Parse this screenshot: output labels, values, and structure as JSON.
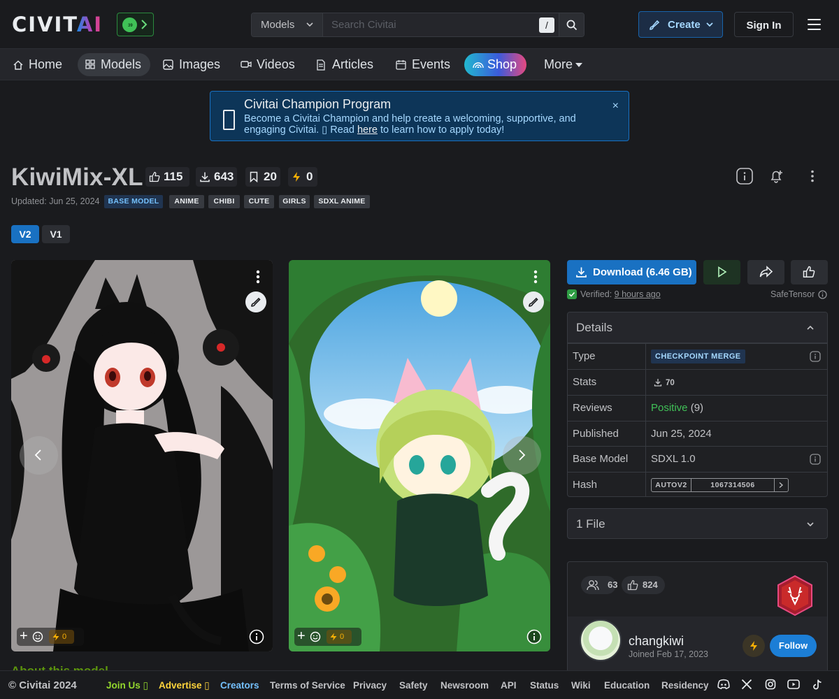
{
  "header": {
    "logo_main": "CIVIT",
    "logo_accent": "AI",
    "badge_number": "39",
    "search_scope": "Models",
    "search_placeholder": "Search Civitai",
    "search_shortcut": "/",
    "create_label": "Create",
    "signin_label": "Sign In"
  },
  "nav": {
    "items": [
      {
        "label": "Home",
        "icon": "home-icon"
      },
      {
        "label": "Models",
        "icon": "grid-icon",
        "active": true
      },
      {
        "label": "Images",
        "icon": "image-icon"
      },
      {
        "label": "Videos",
        "icon": "video-icon"
      },
      {
        "label": "Articles",
        "icon": "article-icon"
      },
      {
        "label": "Events",
        "icon": "calendar-icon"
      },
      {
        "label": "Shop",
        "icon": "rainbow-icon"
      },
      {
        "label": "More",
        "icon": "caret-down-icon"
      }
    ]
  },
  "announcement": {
    "title": "Civitai Champion Program",
    "body_before": "Become a Civitai Champion and help create a welcoming, supportive, and engaging Civitai. ▯ Read ",
    "link": "here",
    "body_after": " to learn how to apply today!",
    "close": "×"
  },
  "model": {
    "title": "KiwiMix-XL",
    "likes": "115",
    "downloads": "643",
    "collected": "20",
    "buzz": "0",
    "updated": "Updated: Jun 25, 2024",
    "tags": [
      "BASE MODEL",
      "ANIME",
      "CHIBI",
      "CUTE",
      "GIRLS",
      "SDXL ANIME"
    ],
    "versions": [
      "V2",
      "V1"
    ],
    "active_version": "V2"
  },
  "gallery": [
    {
      "name": "cat-girl-black-dress",
      "reaction_buzz": "0"
    },
    {
      "name": "cat-girl-green-hair",
      "reaction_buzz": "0"
    }
  ],
  "sidebar": {
    "download_label": "Download (6.46 GB)",
    "verified_label": "Verified:",
    "verified_time": "9 hours ago",
    "format": "SafeTensor",
    "details_title": "Details",
    "details": {
      "type_key": "Type",
      "type_value": "CHECKPOINT MERGE",
      "stats_key": "Stats",
      "stats_value": "70",
      "reviews_key": "Reviews",
      "reviews_value": "Positive",
      "reviews_count": "(9)",
      "published_key": "Published",
      "published_value": "Jun 25, 2024",
      "base_key": "Base Model",
      "base_value": "SDXL 1.0",
      "hash_key": "Hash",
      "hash_type": "AUTOV2",
      "hash_value": "1067314506"
    },
    "files_label": "1 File",
    "creator": {
      "followers": "63",
      "likes": "824",
      "username": "changkiwi",
      "joined": "Joined Feb 17, 2023",
      "follow_label": "Follow"
    }
  },
  "about_heading": "About this model",
  "footer": {
    "copyright": "© Civitai 2024",
    "links": [
      "Join Us ▯",
      "Advertise ▯",
      "Creators",
      "Terms of Service",
      "Privacy",
      "Safety",
      "Newsroom",
      "API",
      "Status",
      "Wiki",
      "Education",
      "Residency"
    ],
    "social": [
      "discord-icon",
      "x-icon",
      "instagram-icon",
      "youtube-icon",
      "tiktok-icon"
    ]
  },
  "colors": {
    "background": "#1a1b1e",
    "accent_blue": "#1971c2",
    "positive_green": "#40c057",
    "buzz_yellow": "#fab005"
  }
}
